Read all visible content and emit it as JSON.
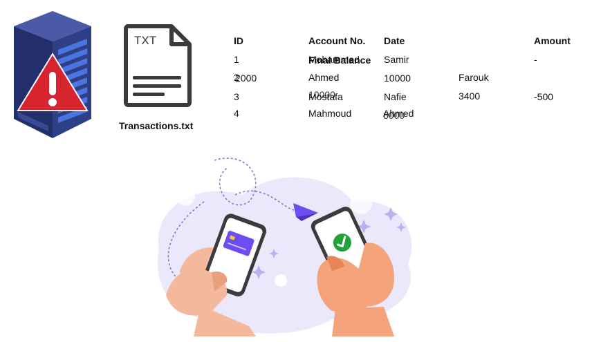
{
  "file": {
    "doc_badge": "TXT",
    "name": "Transactions.txt"
  },
  "table": {
    "headers": {
      "id": "ID",
      "account": "Account No.",
      "date": "Date",
      "amount": "Amount",
      "final_balance": "Final Balance"
    },
    "texts": {
      "r1_id": "1",
      "r1_account": "Mohammed",
      "r1_date": "Samir",
      "r1_amount": "-",
      "r2_id": "2",
      "r2_first": "2000",
      "r2_account": "Ahmed",
      "r2_date": "10000",
      "r2_extra": "Farouk",
      "r3_id": "3",
      "r3_account": "Mostafa",
      "r3_account_overlap": "10000",
      "r3_date": "Nafie",
      "r3_extra": "3400",
      "r3_amount": "-500",
      "r4_id": "4",
      "r4_account": "Mahmoud",
      "r4_date": "Ahmed",
      "r4_date_overlap": "6000"
    }
  },
  "colors": {
    "server_body": "#2f3f86",
    "server_side": "#1f2b63",
    "server_slots": "#3a5ad0",
    "warning": "#d6252f",
    "doc_stroke": "#3a3a3a",
    "blob": "#ebe8fb",
    "card": "#6b4df0",
    "check": "#1fa33a",
    "skin": "#f4a37a",
    "skin_dark": "#e8835a"
  },
  "icons": [
    "server-warning-icon",
    "txt-file-icon",
    "paper-plane-icon",
    "check-icon",
    "credit-card-icon"
  ]
}
